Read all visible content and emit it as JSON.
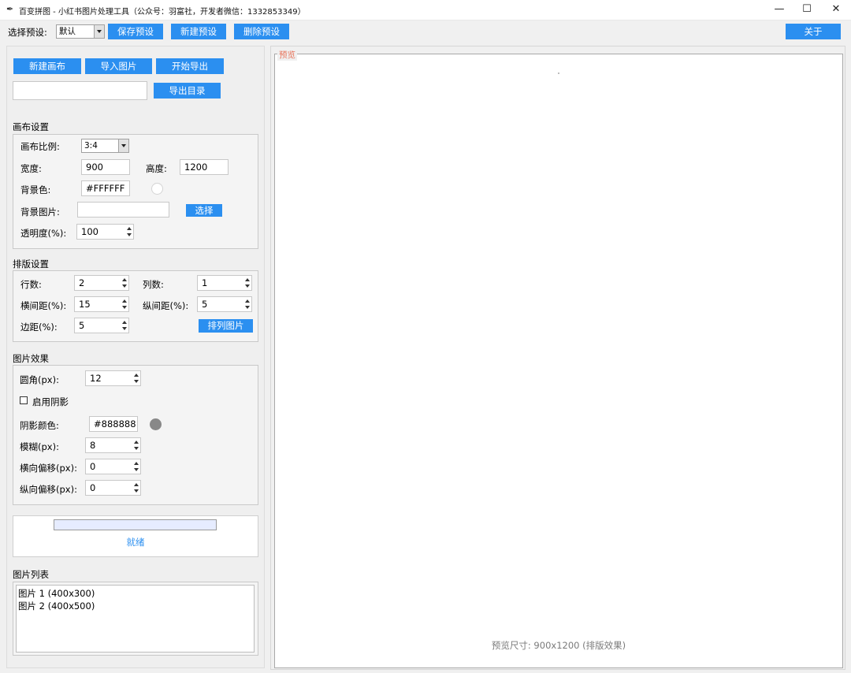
{
  "window": {
    "title": "百变拼图 - 小红书图片处理工具（公众号：羽富社，开发者微信：1332853349）",
    "controls": {
      "minimize": "—",
      "maximize": "☐",
      "close": "✕"
    }
  },
  "toolbar": {
    "preset_label": "选择预设:",
    "preset_value": "默认",
    "save_preset": "保存预设",
    "new_preset": "新建预设",
    "delete_preset": "删除预设",
    "about": "关于"
  },
  "actions": {
    "new_canvas": "新建画布",
    "import_image": "导入图片",
    "start_export": "开始导出",
    "export_dir_value": "",
    "export_dir_button": "导出目录"
  },
  "canvas_settings": {
    "title": "画布设置",
    "ratio_label": "画布比例:",
    "ratio_value": "3:4",
    "width_label": "宽度:",
    "width_value": "900",
    "height_label": "高度:",
    "height_value": "1200",
    "bg_color_label": "背景色:",
    "bg_color_value": "#FFFFFF",
    "bg_color_swatch": "#ffffff",
    "bg_image_label": "背景图片:",
    "bg_image_value": "",
    "choose_button": "选择",
    "opacity_label": "透明度(%):",
    "opacity_value": "100"
  },
  "layout_settings": {
    "title": "排版设置",
    "rows_label": "行数:",
    "rows_value": "2",
    "cols_label": "列数:",
    "cols_value": "1",
    "hgap_label": "横间距(%):",
    "hgap_value": "15",
    "vgap_label": "纵间距(%):",
    "vgap_value": "5",
    "margin_label": "边距(%):",
    "margin_value": "5",
    "arrange_button": "排列图片"
  },
  "image_effects": {
    "title": "图片效果",
    "radius_label": "圆角(px):",
    "radius_value": "12",
    "shadow_checkbox_label": "启用阴影",
    "shadow_enabled": false,
    "shadow_color_label": "阴影颜色:",
    "shadow_color_value": "#888888",
    "shadow_color_swatch": "#888888",
    "blur_label": "模糊(px):",
    "blur_value": "8",
    "hoffset_label": "横向偏移(px):",
    "hoffset_value": "0",
    "voffset_label": "纵向偏移(px):",
    "voffset_value": "0"
  },
  "status": {
    "progress": 0,
    "text": "就绪"
  },
  "image_list": {
    "title": "图片列表",
    "items": [
      "图片 1 (400x300)",
      "图片 2 (400x500)"
    ]
  },
  "preview": {
    "title": "预览",
    "footer": "预览尺寸: 900x1200 (排版效果)"
  },
  "colors": {
    "accent": "#2b8ff0",
    "preview_title": "#e8735a",
    "status_text": "#2b8ff0"
  }
}
